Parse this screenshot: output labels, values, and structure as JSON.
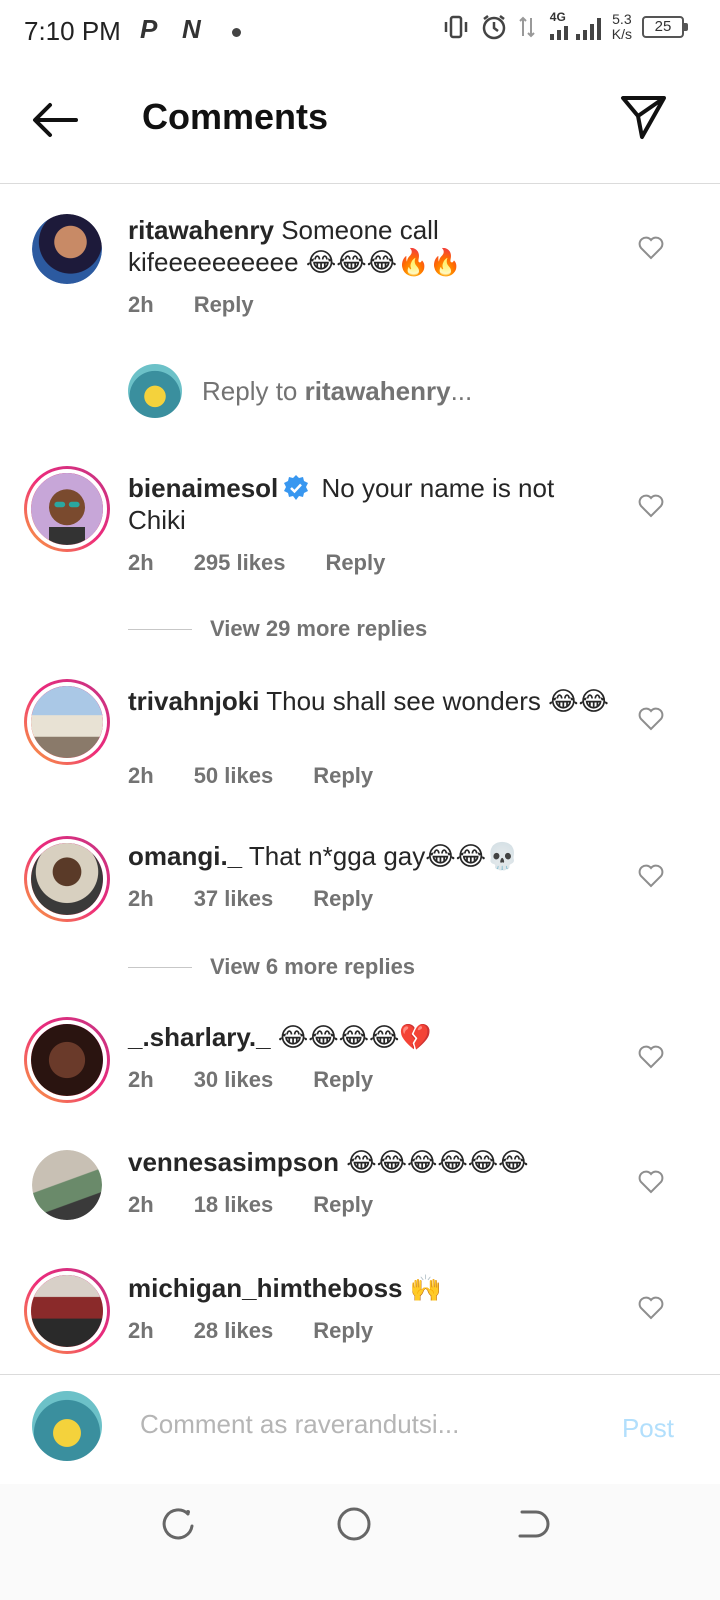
{
  "status_bar": {
    "time": "7:10 PM",
    "app_icons": [
      "P",
      "N"
    ],
    "network": "4G",
    "speed_value": "5.3",
    "speed_unit": "K/s",
    "battery": "25"
  },
  "header": {
    "title": "Comments",
    "back_icon": "arrow-left-icon",
    "send_icon": "paper-plane-icon"
  },
  "comments": [
    {
      "user": "ritawahenry",
      "text": "Someone call kifeeeeeeeeee 😂😂😂🔥🔥",
      "time": "2h",
      "likes": "",
      "reply": "Reply"
    },
    {
      "user": "bienaimesol",
      "verified": true,
      "text": "No your name is not Chiki",
      "time": "2h",
      "likes": "295 likes",
      "reply": "Reply"
    },
    {
      "user": "trivahnjoki",
      "text": "Thou shall see wonders 😂😂",
      "time": "2h",
      "likes": "50 likes",
      "reply": "Reply"
    },
    {
      "user": "omangi._",
      "text": "That n*gga gay😂😂💀",
      "time": "2h",
      "likes": "37 likes",
      "reply": "Reply"
    },
    {
      "user": "_.sharlary._",
      "text": "😂😂😂😂💔",
      "time": "2h",
      "likes": "30 likes",
      "reply": "Reply"
    },
    {
      "user": "vennesasimpson",
      "text": "😂😂😂😂😂😂",
      "time": "2h",
      "likes": "18 likes",
      "reply": "Reply"
    },
    {
      "user": "michigan_himtheboss",
      "text": "🙌",
      "time": "2h",
      "likes": "28 likes",
      "reply": "Reply"
    }
  ],
  "reply_to": {
    "prefix": "Reply to ",
    "user": "ritawahenry",
    "suffix": "..."
  },
  "view_more": [
    "View 29 more replies",
    "View 6 more replies"
  ],
  "composer": {
    "placeholder": "Comment as raverandutsi...",
    "post_label": "Post"
  },
  "colors": {
    "ring_start": "#f9a73b",
    "ring_end": "#c13584",
    "verified": "#3897f0",
    "post_disabled": "#b2dffc"
  }
}
